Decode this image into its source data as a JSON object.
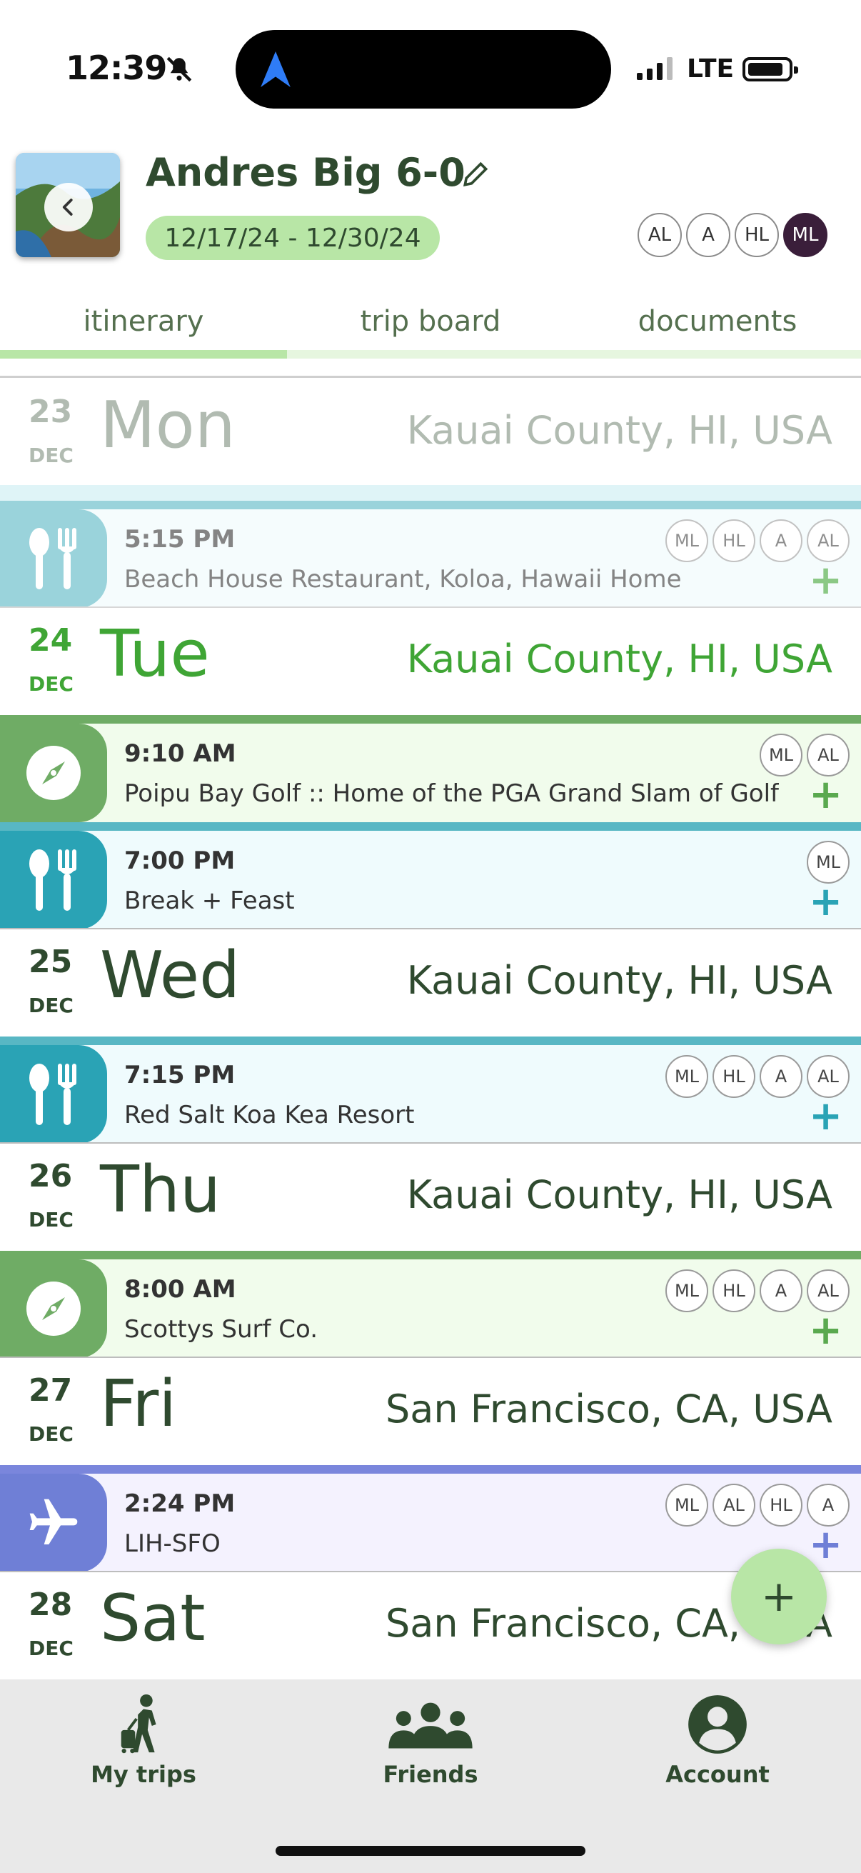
{
  "status_bar": {
    "time": "12:39",
    "network": "LTE"
  },
  "trip": {
    "title": "Andres Big 6-0",
    "dates": "12/17/24 - 12/30/24",
    "members": [
      "AL",
      "A",
      "HL",
      "ML"
    ]
  },
  "tabs": [
    {
      "label": "itinerary",
      "active": true
    },
    {
      "label": "trip board",
      "active": false
    },
    {
      "label": "documents",
      "active": false
    }
  ],
  "days": [
    {
      "num": "23",
      "month": "DEC",
      "name": "Mon",
      "location": "Kauai County, HI, USA"
    },
    {
      "num": "24",
      "month": "DEC",
      "name": "Tue",
      "location": "Kauai County, HI, USA"
    },
    {
      "num": "25",
      "month": "DEC",
      "name": "Wed",
      "location": "Kauai County, HI, USA"
    },
    {
      "num": "26",
      "month": "DEC",
      "name": "Thu",
      "location": "Kauai County, HI, USA"
    },
    {
      "num": "27",
      "month": "DEC",
      "name": "Fri",
      "location": "San Francisco, CA, USA"
    },
    {
      "num": "28",
      "month": "DEC",
      "name": "Sat",
      "location": "San Francisco, CA, USA"
    }
  ],
  "events": [
    {
      "time": "5:15 PM",
      "name": "Beach House Restaurant, Koloa, Hawaii Home",
      "type": "dining",
      "members": [
        "ML",
        "HL",
        "A",
        "AL"
      ]
    },
    {
      "time": "9:10 AM",
      "name": "Poipu Bay Golf :: Home of the PGA Grand Slam of Golf",
      "type": "activity",
      "members": [
        "ML",
        "AL"
      ]
    },
    {
      "time": "7:00 PM",
      "name": "Break + Feast",
      "type": "dining",
      "members": [
        "ML"
      ]
    },
    {
      "time": "7:15 PM",
      "name": "Red Salt Koa Kea Resort",
      "type": "dining",
      "members": [
        "ML",
        "HL",
        "A",
        "AL"
      ]
    },
    {
      "time": "8:00 AM",
      "name": "Scottys Surf Co.",
      "type": "activity",
      "members": [
        "ML",
        "HL",
        "A",
        "AL"
      ]
    },
    {
      "time": "2:24 PM",
      "name": "LIH-SFO",
      "type": "flight",
      "members": [
        "ML",
        "AL",
        "HL",
        "A"
      ]
    }
  ],
  "colors": {
    "dining": "#58b7c4",
    "dining_bg": "#effbfd",
    "activity": "#6fac65",
    "activity_bg": "#f1fcec",
    "flight": "#7a86dc",
    "flight_bg": "#f4f2fe",
    "pill": "#b8e6a6",
    "accent_green": "#3fa535",
    "text": "#2f4a2f"
  },
  "fab_label": "+",
  "bottom_nav": [
    {
      "label": "My trips",
      "icon": "traveler-icon"
    },
    {
      "label": "Friends",
      "icon": "group-icon"
    },
    {
      "label": "Account",
      "icon": "account-icon"
    }
  ]
}
